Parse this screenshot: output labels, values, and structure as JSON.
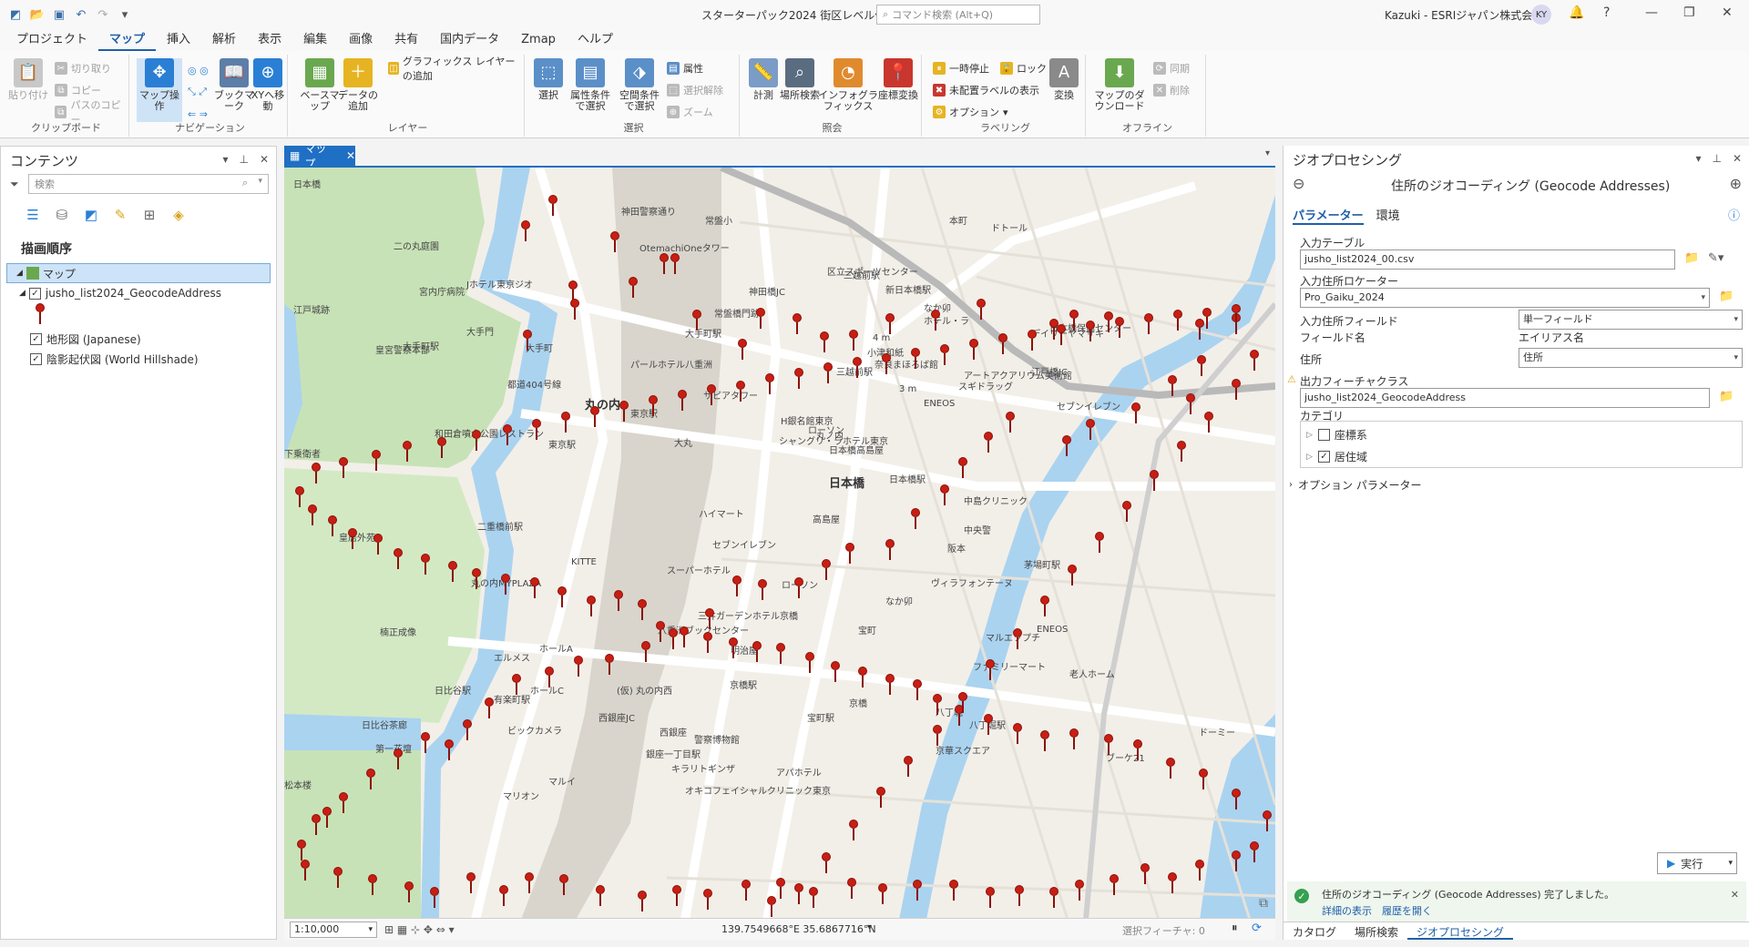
{
  "window": {
    "title": "スターターパック2024 街区レベル住所",
    "command_search_placeholder": "コマンド検索 (Alt+Q)",
    "user": "Kazuki - ESRIジャパン株式会社",
    "avatar": "KY"
  },
  "ribbon_tabs": [
    "プロジェクト",
    "マップ",
    "挿入",
    "解析",
    "表示",
    "編集",
    "画像",
    "共有",
    "国内データ",
    "Zmap",
    "ヘルプ"
  ],
  "ribbon": {
    "clipboard": {
      "label": "クリップボード",
      "paste": "貼り付け",
      "cut": "切り取り",
      "copy": "コピー",
      "copy_path": "パスのコピー"
    },
    "navigation": {
      "label": "ナビゲーション",
      "explore": "マップ操作",
      "bookmarks": "ブックマーク",
      "goto_xy": "XYへ移動"
    },
    "layer": {
      "label": "レイヤー",
      "basemap": "ベースマップ",
      "add_data": "データの追加",
      "add_graphics": "グラフィックス レイヤーの追加"
    },
    "selection": {
      "label": "選択",
      "select": "選択",
      "select_by_attr": "属性条件で選択",
      "select_by_loc": "空間条件で選択",
      "attributes": "属性",
      "clear": "選択解除",
      "zoom": "ズーム"
    },
    "inquiry": {
      "label": "照会",
      "measure": "計測",
      "locate": "場所検索",
      "infographics": "インフォグラフィックス",
      "convert_coords": "座標変換"
    },
    "labeling": {
      "label": "ラベリング",
      "pause": "一時停止",
      "lock": "ロック",
      "unplaced": "未配置ラベルの表示",
      "convert": "変換",
      "options": "オプション"
    },
    "offline": {
      "label": "オフライン",
      "download": "マップのダウンロード",
      "sync": "同期",
      "remove": "削除"
    }
  },
  "contents": {
    "title": "コンテンツ",
    "search_placeholder": "検索",
    "section": "描画順序",
    "map": "マップ",
    "layers": [
      {
        "name": "jusho_list2024_GeocodeAddress",
        "checked": true
      },
      {
        "name": "地形図 (Japanese)",
        "checked": true
      },
      {
        "name": "陰影起伏図 (World Hillshade)",
        "checked": true
      }
    ]
  },
  "map_view": {
    "tab": "マップ",
    "scale": "1:10,000",
    "coords": "139.7549668°E 35.6867716°N",
    "selected_features": "選択フィーチャ: 0",
    "labels": [
      {
        "t": "二の丸庭園"
      },
      {
        "t": "宮内庁病院"
      },
      {
        "t": "江戸城跡"
      },
      {
        "t": "皇宮警察本部"
      },
      {
        "t": "大手門"
      },
      {
        "t": "大手町"
      },
      {
        "t": "丸の内",
        "big": true
      },
      {
        "t": "和田倉噴水公園レストラン"
      },
      {
        "t": "下乗衛者"
      },
      {
        "t": "皇居外苑"
      },
      {
        "t": "二重橋前駅"
      },
      {
        "t": "丸の内MYPLAZA"
      },
      {
        "t": "KITTE"
      },
      {
        "t": "楠正成像"
      },
      {
        "t": "エルメス"
      },
      {
        "t": "ホールA"
      },
      {
        "t": "ホールC"
      },
      {
        "t": "有楽町駅"
      },
      {
        "t": "日比谷駅"
      },
      {
        "t": "日比谷茶廊"
      },
      {
        "t": "第一花壇"
      },
      {
        "t": "松本楼"
      },
      {
        "t": "ビックカメラ"
      },
      {
        "t": "西銀座JC"
      },
      {
        "t": "(仮) 丸の内西"
      },
      {
        "t": "西銀座"
      },
      {
        "t": "警察博物館"
      },
      {
        "t": "キラリトギンザ"
      },
      {
        "t": "マリオン"
      },
      {
        "t": "マルイ"
      },
      {
        "t": "オキコフェイシャルクリニック東京"
      },
      {
        "t": "アパホテル"
      },
      {
        "t": "銀座一丁目駅"
      },
      {
        "t": "八重洲ブックセンター"
      },
      {
        "t": "明治屋"
      },
      {
        "t": "京橋駅"
      },
      {
        "t": "宝町駅"
      },
      {
        "t": "京橋"
      },
      {
        "t": "宝町"
      },
      {
        "t": "八丁堀"
      },
      {
        "t": "京華スクエア"
      },
      {
        "t": "八丁堀駅"
      },
      {
        "t": "ファミリーマート"
      },
      {
        "t": "マルエツプチ"
      },
      {
        "t": "ヴィラフォンテーヌ"
      },
      {
        "t": "なか卯"
      },
      {
        "t": "阪本"
      },
      {
        "t": "中央警"
      },
      {
        "t": "茅場町駅"
      },
      {
        "t": "中島クリニック"
      },
      {
        "t": "ENEOS"
      },
      {
        "t": "老人ホーム"
      },
      {
        "t": "ドーミー"
      },
      {
        "t": "ブーケ21"
      },
      {
        "t": "ローソン"
      },
      {
        "t": "三井ガーデンホテル京橋"
      },
      {
        "t": "スーパーホテル"
      },
      {
        "t": "セブンイレブン"
      },
      {
        "t": "ハイマート"
      },
      {
        "t": "高島屋"
      },
      {
        "t": "日本橋高島屋"
      },
      {
        "t": "日本橋",
        "big": true
      },
      {
        "t": "日本橋駅"
      },
      {
        "t": "大丸"
      },
      {
        "t": "東京駅"
      },
      {
        "t": "シャングリ・ラホテル東京"
      },
      {
        "t": "H銀名館東京"
      },
      {
        "t": "パールホテル八重洲"
      },
      {
        "t": "サピアタワー"
      },
      {
        "t": "丸ノ内"
      },
      {
        "t": "ローソン"
      },
      {
        "t": "大手町駅"
      },
      {
        "t": "常盤橋門跡"
      },
      {
        "t": "Jホテル東京ジオ"
      },
      {
        "t": "OtemachiOneタワー"
      },
      {
        "t": "神田橋JC"
      },
      {
        "t": "神田警察通り"
      },
      {
        "t": "常盤小"
      },
      {
        "t": "区立スポーツセンター"
      },
      {
        "t": "三越前駅"
      },
      {
        "t": "新日本橋駅"
      },
      {
        "t": "小津和紙"
      },
      {
        "t": "本町"
      },
      {
        "t": "ドトール"
      },
      {
        "t": "デイリーヤマザキ"
      },
      {
        "t": "日本橋保健センター"
      },
      {
        "t": "ホテル・ラ"
      },
      {
        "t": "なか卯"
      },
      {
        "t": "ENEOS"
      },
      {
        "t": "アートアクアリウム美術館"
      },
      {
        "t": "奈良まほろば館"
      },
      {
        "t": "三越前駅"
      },
      {
        "t": "スギドラッグ"
      },
      {
        "t": "セブンイレブン"
      },
      {
        "t": "江戸橋JC"
      },
      {
        "t": "東京駅"
      },
      {
        "t": "大手町駅"
      },
      {
        "t": "都道404号線"
      },
      {
        "t": "3 m"
      },
      {
        "t": "4 m"
      },
      {
        "t": "日本橋"
      }
    ]
  },
  "geoprocessing": {
    "title": "ジオプロセシング",
    "tool": "住所のジオコーディング (Geocode Addresses)",
    "tab_params": "パラメーター",
    "tab_env": "環境",
    "input_table_label": "入力テーブル",
    "input_table": "jusho_list2024_00.csv",
    "input_locator_label": "入力住所ロケーター",
    "input_locator": "Pro_Gaiku_2024",
    "address_fields_label": "入力住所フィールド",
    "address_fields": "単一フィールド",
    "field_name_label": "フィールド名",
    "alias_label": "エイリアス名",
    "address_label": "住所",
    "address_value": "住所",
    "output_fc_label": "出力フィーチャクラス",
    "output_fc": "jusho_list2024_GeocodeAddress",
    "category_label": "カテゴリ",
    "cat1": "座標系",
    "cat2": "居住域",
    "options_label": "オプション パラメーター",
    "run": "実行",
    "msg": "住所のジオコーディング (Geocode Addresses) 完了しました。",
    "msg_details": "詳細の表示",
    "msg_history": "履歴を開く",
    "bottom_tabs": [
      "カタログ",
      "場所検索",
      "ジオプロセシング"
    ]
  },
  "colors": {
    "accent": "#1f6fc4",
    "pin": "#c81e14",
    "water": "#aad3f0",
    "park": "#c6e3b8"
  }
}
